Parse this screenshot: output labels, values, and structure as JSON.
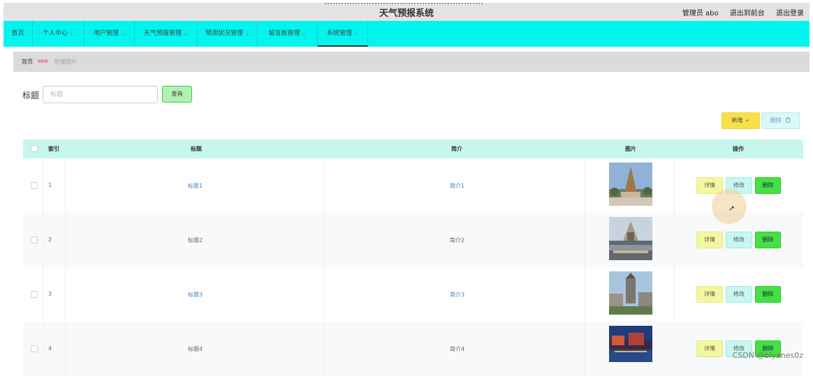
{
  "app": {
    "title": "天气预报系统"
  },
  "header": {
    "user_label": "管理员 abo",
    "to_front": "退出到前台",
    "logout": "退出登录"
  },
  "nav": {
    "items": [
      {
        "label": "首页",
        "dropdown": false
      },
      {
        "label": "个人中心",
        "dropdown": true
      },
      {
        "label": "用户管理",
        "dropdown": true
      },
      {
        "label": "天气预报管理",
        "dropdown": true
      },
      {
        "label": "预测状况管理",
        "dropdown": true
      },
      {
        "label": "留言板管理",
        "dropdown": true
      },
      {
        "label": "系统管理",
        "dropdown": true,
        "active": true
      }
    ]
  },
  "breadcrumb": {
    "home": "首页",
    "separator": "eee",
    "current": "轮播图片"
  },
  "search": {
    "label": "标题",
    "placeholder": "标题",
    "button": "查询"
  },
  "toolbar": {
    "add": "新增",
    "add_icon": "+",
    "delete": "删除",
    "delete_icon": "trash-icon"
  },
  "table": {
    "columns": {
      "index": "索引",
      "title": "标题",
      "intro": "简介",
      "image": "图片",
      "action": "操作"
    },
    "rows": [
      {
        "index": "1",
        "title": "标题1",
        "intro": "简介1",
        "image": "temple-photo"
      },
      {
        "index": "2",
        "title": "标题2",
        "intro": "简介2",
        "image": "monument-lake-photo"
      },
      {
        "index": "3",
        "title": "标题3",
        "intro": "简介3",
        "image": "city-tower-photo"
      },
      {
        "index": "4",
        "title": "标题4",
        "intro": "简介4",
        "image": "night-riverside-photo"
      }
    ],
    "actions": {
      "detail": "详情",
      "edit": "修改",
      "remove": "删除"
    }
  },
  "watermark": "CSDN @biyanes0z",
  "colors": {
    "nav_bg": "#00f5ee",
    "header_bg": "#e4e2e3",
    "table_head_bg": "#c7f6ec",
    "add_btn": "#f5e148",
    "detail_btn": "#f3f7a0",
    "edit_btn": "#c8f6f1",
    "remove_btn": "#44e044"
  }
}
